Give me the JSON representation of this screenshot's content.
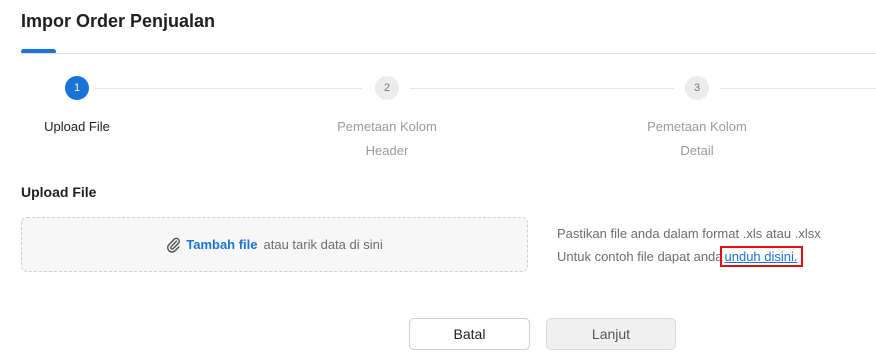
{
  "page": {
    "title": "Impor Order Penjualan"
  },
  "stepper": {
    "steps": [
      {
        "number": "1",
        "label_line1": "Upload File",
        "label_line2": "",
        "state": "active"
      },
      {
        "number": "2",
        "label_line1": "Pemetaan Kolom",
        "label_line2": "Header",
        "state": "inactive"
      },
      {
        "number": "3",
        "label_line1": "Pemetaan Kolom",
        "label_line2": "Detail",
        "state": "inactive"
      }
    ]
  },
  "upload": {
    "section_title": "Upload File",
    "icon": "paperclip-icon",
    "add_file_label": "Tambah file",
    "drag_text": "atau tarik data di sini",
    "hint_line1": "Pastikan file anda dalam format .xls atau .xlsx",
    "hint_line2_prefix": "Untuk contoh file dapat anda",
    "download_link": "unduh disini."
  },
  "actions": {
    "cancel_label": "Batal",
    "next_label": "Lanjut"
  },
  "colors": {
    "accent": "#1a73d9",
    "highlight_box": "#e01010"
  }
}
